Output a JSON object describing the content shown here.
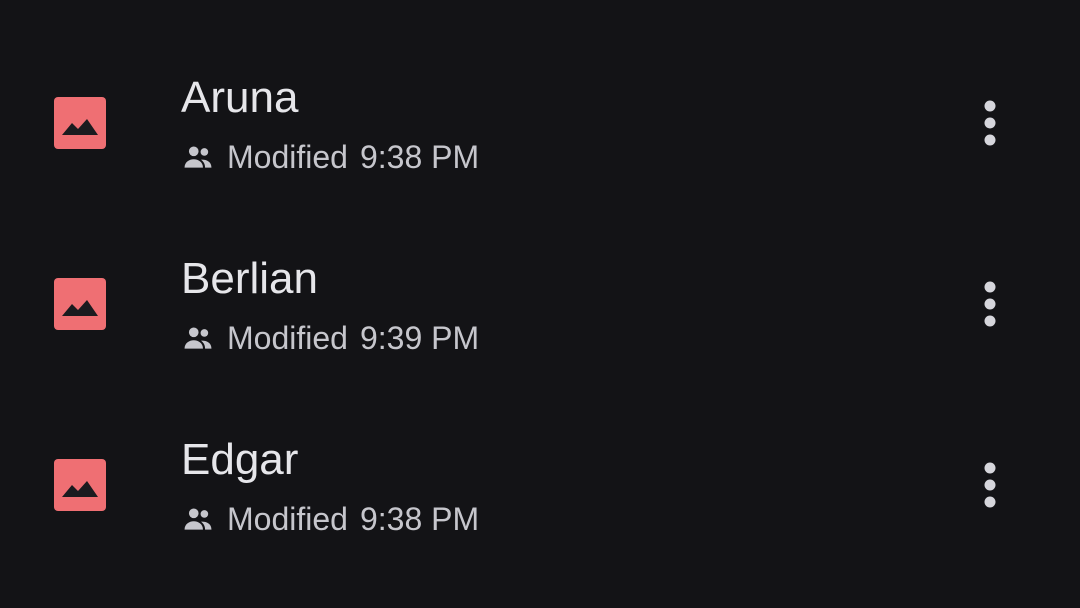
{
  "files": [
    {
      "name": "Aruna",
      "modified_label": "Modified",
      "modified_time": "9:38 PM",
      "icon": "image-icon",
      "shared_icon": "shared-people-icon",
      "menu_icon": "more-vert-icon"
    },
    {
      "name": "Berlian",
      "modified_label": "Modified",
      "modified_time": "9:39 PM",
      "icon": "image-icon",
      "shared_icon": "shared-people-icon",
      "menu_icon": "more-vert-icon"
    },
    {
      "name": "Edgar",
      "modified_label": "Modified",
      "modified_time": "9:38 PM",
      "icon": "image-icon",
      "shared_icon": "shared-people-icon",
      "menu_icon": "more-vert-icon"
    }
  ],
  "colors": {
    "background": "#131316",
    "image_icon": "#ef6f73",
    "title_text": "#e6e6ea",
    "meta_text": "#c6c6cc"
  }
}
